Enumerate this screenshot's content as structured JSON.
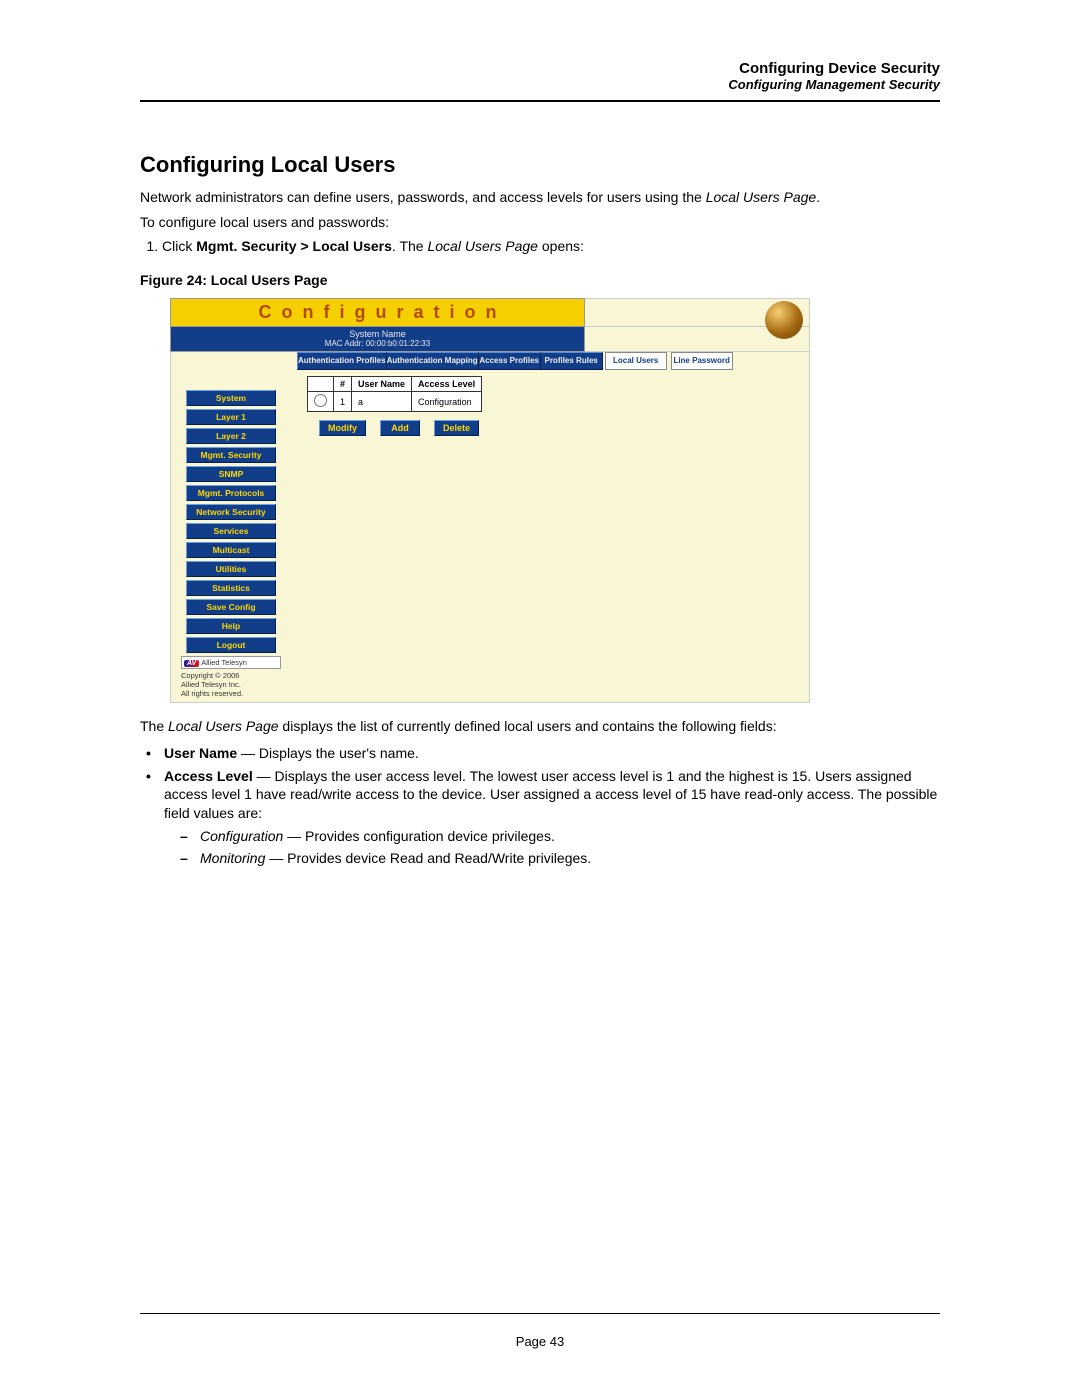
{
  "header": {
    "title": "Configuring Device Security",
    "subtitle": "Configuring Management Security"
  },
  "h1": "Configuring Local Users",
  "intro": {
    "pre": "Network administrators can define users, passwords, and access levels for users using the ",
    "em": "Local Users Page",
    "post": "."
  },
  "to_configure": "To configure local users and passwords:",
  "step1": {
    "pre": "Click ",
    "b": "Mgmt. Security > Local Users",
    "mid": ". The ",
    "em": "Local Users Page",
    "post": " opens:"
  },
  "figure_caption": "Figure 24:  Local Users Page",
  "screenshot": {
    "title": "Configuration",
    "system_name_label": "System Name",
    "mac_line": "MAC Addr:  00:00:b0:01:22:33",
    "tabs": [
      "Authentication Profiles",
      "Authentication Mapping",
      "Access Profiles",
      "Profiles Rules",
      "Local Users",
      "Line Password"
    ],
    "nav": [
      "System",
      "Layer 1",
      "Layer 2",
      "Mgmt. Security",
      "SNMP",
      "Mgmt. Protocols",
      "Network Security",
      "Services",
      "Multicast",
      "Utilities",
      "Statistics",
      "Save Config",
      "Help",
      "Logout"
    ],
    "table": {
      "headers": [
        "#",
        "User Name",
        "Access Level"
      ],
      "rows": [
        {
          "num": "1",
          "user": "a",
          "level": "Configuration"
        }
      ]
    },
    "actions": [
      "Modify",
      "Add",
      "Delete"
    ],
    "brand": "Allied Telesyn",
    "copyright1": "Copyright © 2006",
    "copyright2": "Allied Telesyn Inc.",
    "copyright3": "All rights reserved."
  },
  "after_figure": {
    "pre": "The ",
    "em": "Local Users Page",
    "post": " displays the list of currently defined local users and contains the following fields:"
  },
  "field_username": {
    "name": "User Name",
    "desc": " — Displays the user's name."
  },
  "field_access": {
    "name": "Access Level",
    "desc": " — Displays the user access level. The lowest user access level is 1 and the highest is 15. Users assigned access level 1 have read/write access to the device. User assigned a access level of 15 have read-only access. The possible field values are:"
  },
  "val_config": {
    "name": "Configuration",
    "desc": " — Provides configuration device privileges."
  },
  "val_monitor": {
    "name": "Monitoring",
    "desc": " — Provides device Read and Read/Write privileges."
  },
  "page_number": "Page 43"
}
